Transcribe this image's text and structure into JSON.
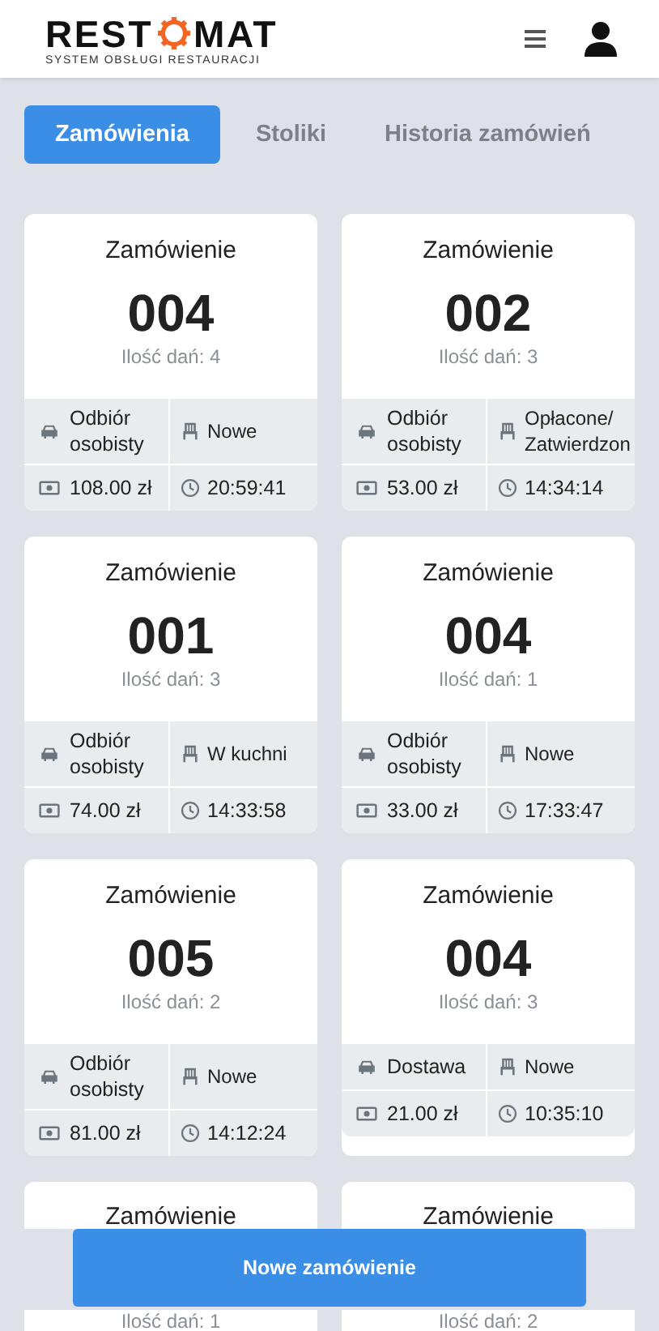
{
  "header": {
    "logo_start": "REST",
    "logo_end": "MAT",
    "logo_subtitle": "SYSTEM OBSŁUGI RESTAURACJI"
  },
  "tabs": [
    {
      "label": "Zamówienia",
      "selected": true
    },
    {
      "label": "Stoliki",
      "selected": false
    },
    {
      "label": "Historia zamówień",
      "selected": false
    }
  ],
  "orders": [
    {
      "title": "Zamówienie",
      "number": "004",
      "dishes": "Ilość dań: 4",
      "delivery": "Odbiór osobisty",
      "status": "Nowe",
      "price": "108.00 zł",
      "time": "20:59:41"
    },
    {
      "title": "Zamówienie",
      "number": "002",
      "dishes": "Ilość dań: 3",
      "delivery": "Odbiór osobisty",
      "status": "Opłacone/ Zatwierdzon",
      "price": "53.00 zł",
      "time": "14:34:14"
    },
    {
      "title": "Zamówienie",
      "number": "001",
      "dishes": "Ilość dań: 3",
      "delivery": "Odbiór osobisty",
      "status": "W kuchni",
      "price": "74.00 zł",
      "time": "14:33:58"
    },
    {
      "title": "Zamówienie",
      "number": "004",
      "dishes": "Ilość dań: 1",
      "delivery": "Odbiór osobisty",
      "status": "Nowe",
      "price": "33.00 zł",
      "time": "17:33:47"
    },
    {
      "title": "Zamówienie",
      "number": "005",
      "dishes": "Ilość dań: 2",
      "delivery": "Odbiór osobisty",
      "status": "Nowe",
      "price": "81.00 zł",
      "time": "14:12:24"
    },
    {
      "title": "Zamówienie",
      "number": "004",
      "dishes": "Ilość dań: 3",
      "delivery": "Dostawa",
      "status": "Nowe",
      "price": "21.00 zł",
      "time": "10:35:10"
    },
    {
      "title": "Zamówienie",
      "dishes": "Ilość dań: 1"
    },
    {
      "title": "Zamówienie",
      "dishes": "Ilość dań: 2"
    }
  ],
  "new_order_button": "Nowe zamówienie"
}
